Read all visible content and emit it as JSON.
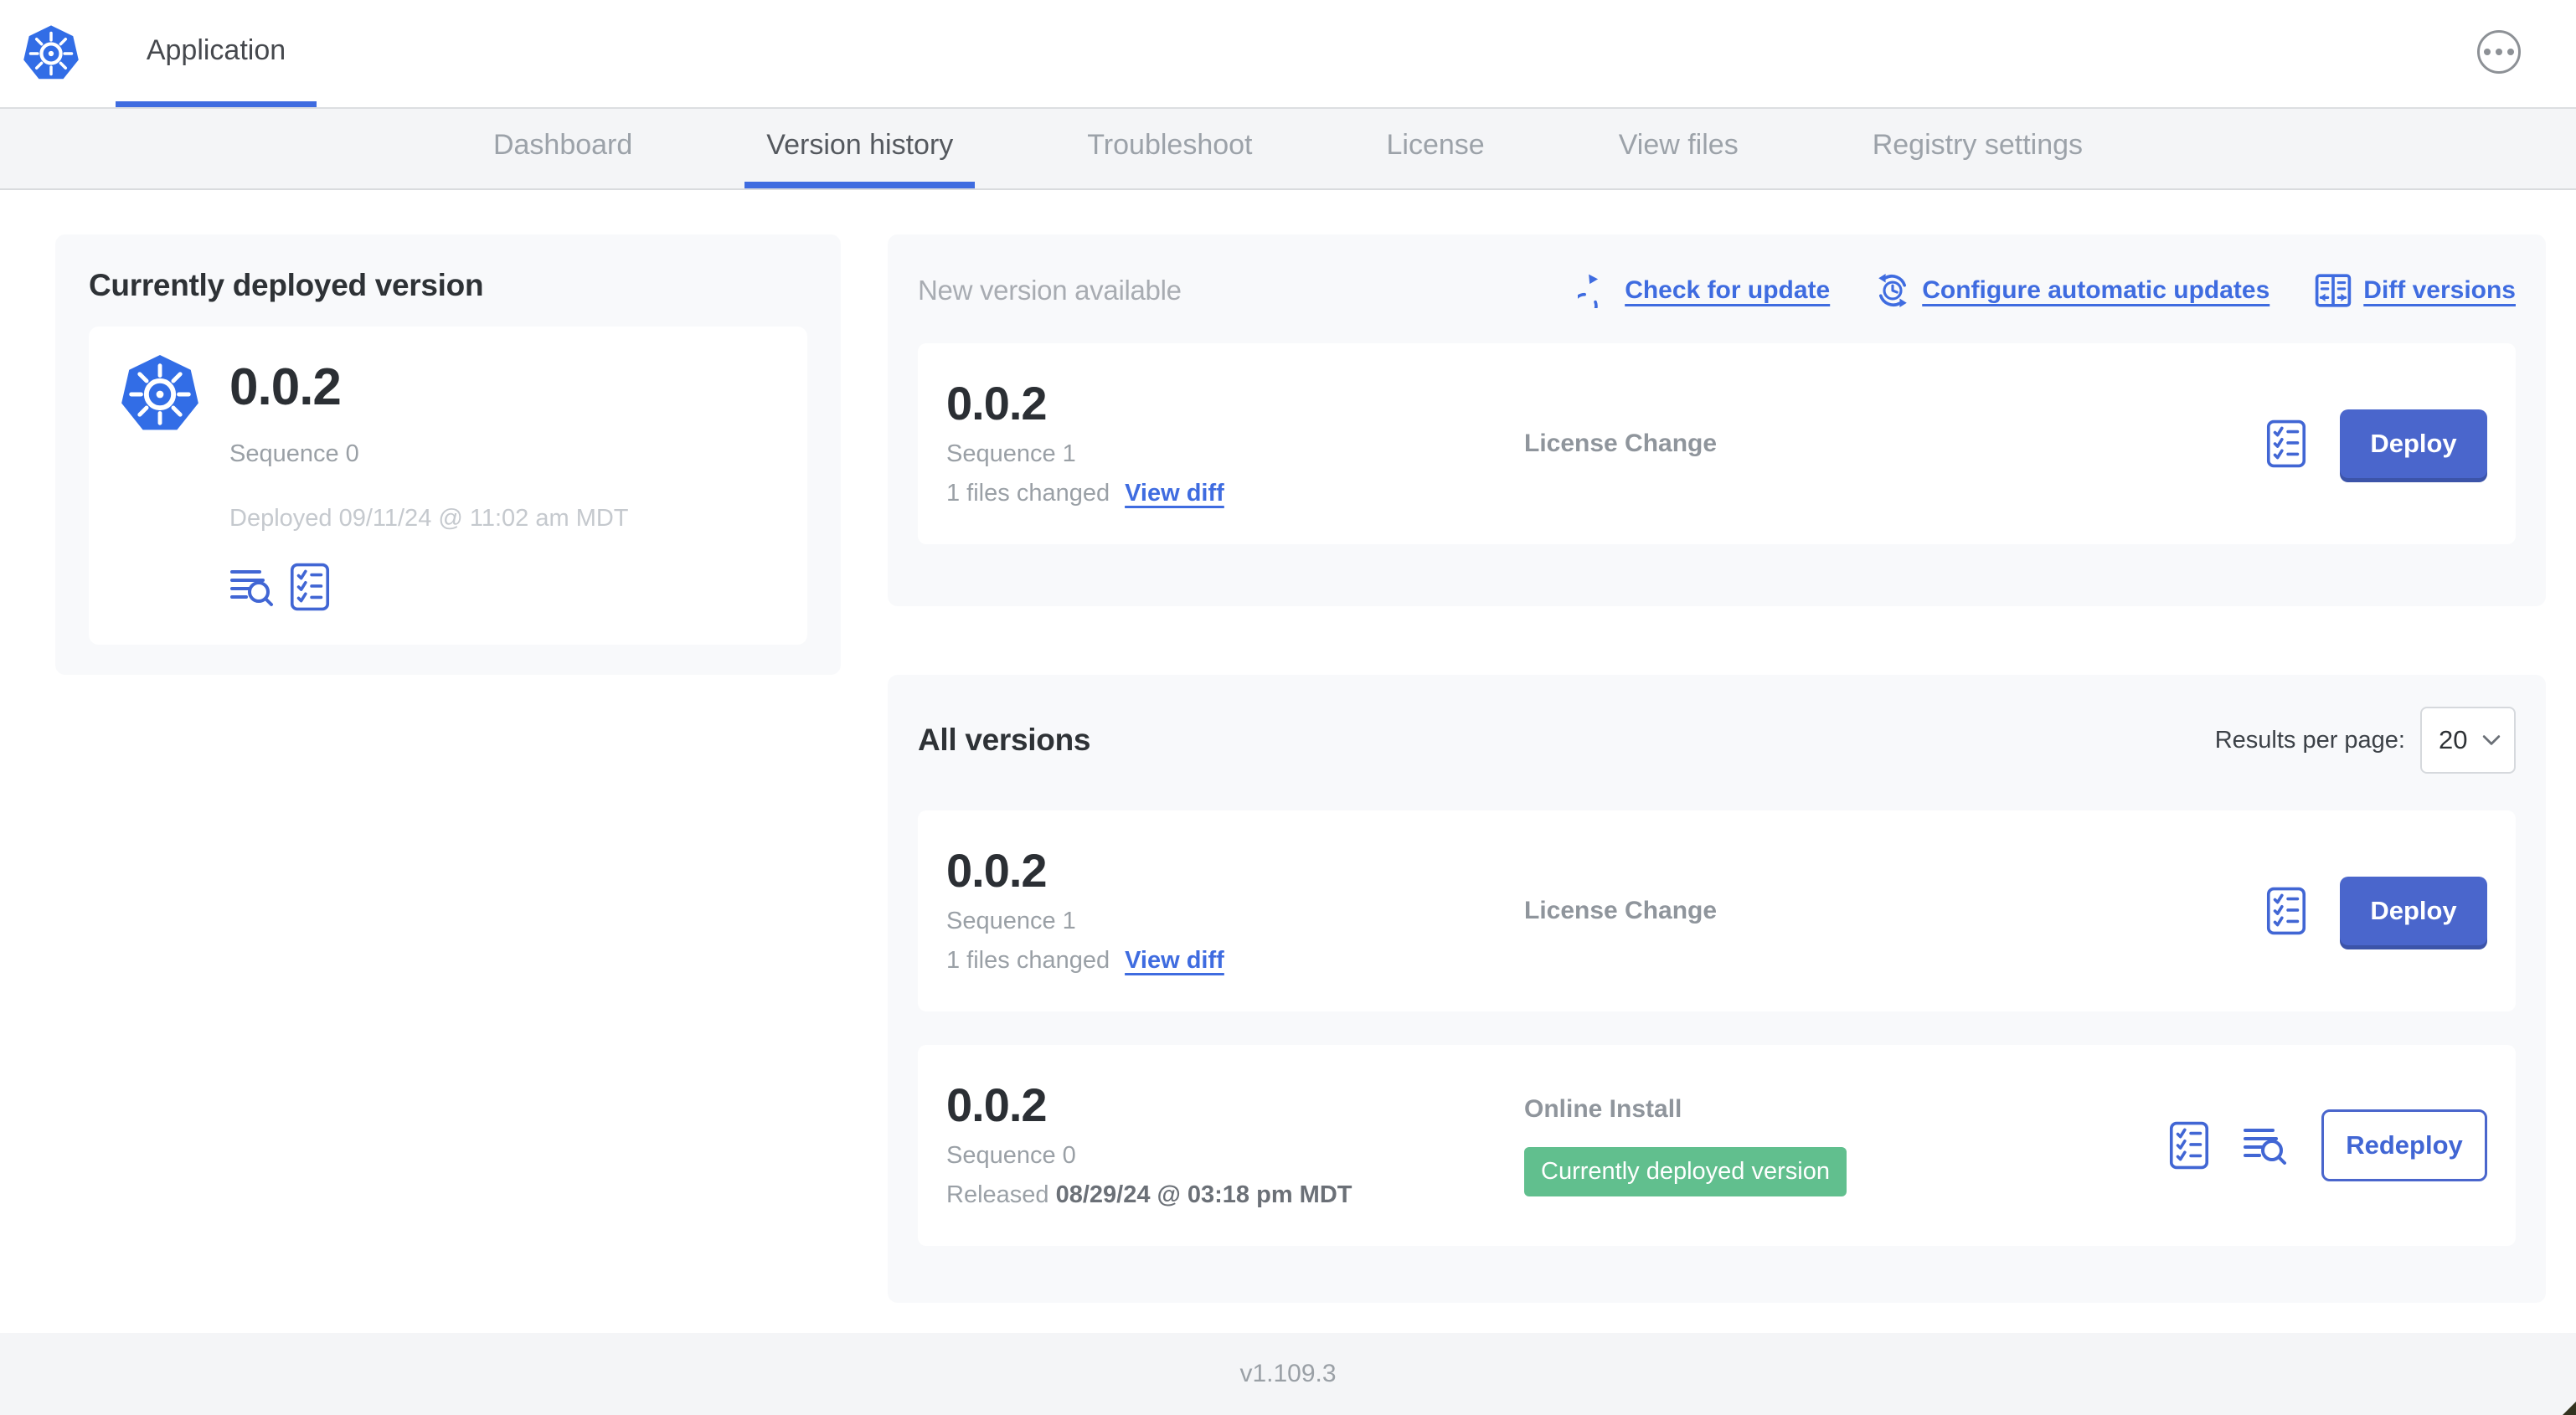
{
  "colors": {
    "accent_blue": "#3f6ce0",
    "button_blue": "#4a66cc",
    "button_blue_shadow": "#3c54a9",
    "badge_green": "#61bf8e",
    "logo_blue": "#326de6",
    "panel_gray": "#f8f9fb",
    "nav_gray": "#f4f5f7"
  },
  "header": {
    "app_title": "Application"
  },
  "nav": {
    "active_tab": "Version history",
    "tabs": [
      "Dashboard",
      "Version history",
      "Troubleshoot",
      "License",
      "View files",
      "Registry settings"
    ]
  },
  "current_version": {
    "title": "Currently deployed version",
    "version": "0.0.2",
    "sequence": "Sequence 0",
    "deployed": "Deployed 09/11/24 @ 11:02 am MDT"
  },
  "new_version": {
    "title": "New version available",
    "check_for_update": "Check for update",
    "configure_automatic_updates": "Configure automatic updates",
    "diff_versions": "Diff versions",
    "card": {
      "version": "0.0.2",
      "sequence": "Sequence 1",
      "files_changed": "1 files changed",
      "view_diff": "View diff",
      "source": "License Change",
      "action": "Deploy"
    }
  },
  "all_versions": {
    "title": "All versions",
    "results_per_page_label": "Results per page:",
    "results_per_page_value": "20",
    "rows": [
      {
        "version": "0.0.2",
        "sequence": "Sequence 1",
        "files_changed": "1 files changed",
        "view_diff": "View diff",
        "source": "License Change",
        "action": "Deploy"
      },
      {
        "version": "0.0.2",
        "sequence": "Sequence 0",
        "released_label": "Released",
        "released_date": "08/29/24 @ 03:18 pm MDT",
        "source": "Online Install",
        "badge": "Currently deployed version",
        "action": "Redeploy"
      }
    ]
  },
  "footer": {
    "app_version": "v1.109.3"
  }
}
